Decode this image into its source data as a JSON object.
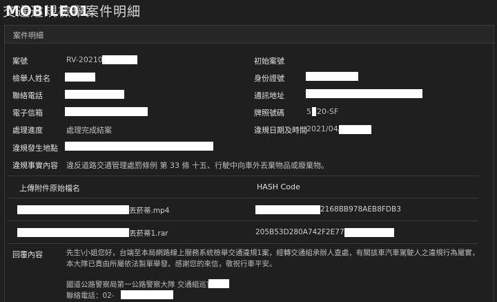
{
  "header": {
    "title": "交通違規檢舉案件明細",
    "watermark": "MOBILE01"
  },
  "panel": {
    "heading": "案件明細"
  },
  "fields": {
    "case_no_label": "案號",
    "case_no_value": "RV-202104",
    "orig_case_label": "初始案號",
    "reporter_label": "檢舉人姓名",
    "id_label": "身份證號",
    "phone_label": "聯絡電話",
    "address_label": "通訊地址",
    "email_label": "電子信箱",
    "plate_label": "牌照號碼",
    "plate_prefix": "5",
    "plate_suffix": "20-SF",
    "status_label": "處理進度",
    "status_value": "處理完成結案",
    "date_label": "違規日期及時間",
    "date_value": "2021/04/",
    "place_label": "違規發生地點",
    "fact_label": "違規事實內容",
    "fact_value": "違反道路交通管理處罰條例 第 33 條 十五、行駛中向車外丟棄物品或廢棄物。"
  },
  "attachments": {
    "col_name": "上傳附件原始檔名",
    "col_hash": "HASH Code",
    "rows": [
      {
        "name_suffix": "丟菸蒂.mp4",
        "hash_suffix": "2168BB978AEB8FDB3"
      },
      {
        "name_suffix": "丟菸蒂1.rar",
        "hash_prefix": "205B53D280A742F2E77"
      }
    ]
  },
  "reply": {
    "label": "回覆內容",
    "paragraph": "先生\\小姐您好，台端至本局網路線上服務系統檢舉交通違規1案，經轉交通組承辦人查處，有關該車汽車駕駛人之違規行為屬實，本大隊已責由所屬依法製單舉發。感謝您的來信，敬祝行車平安。",
    "signature": "國道公路警察局第一公路警察大隊 交通組巡官",
    "contact": "聯絡電話：02-"
  }
}
